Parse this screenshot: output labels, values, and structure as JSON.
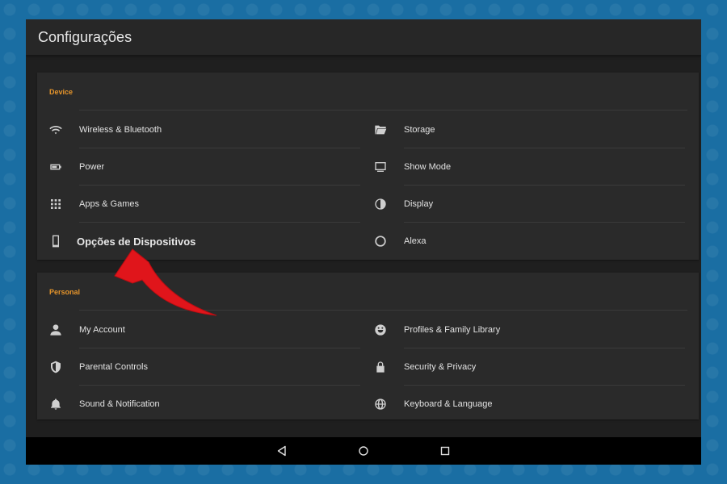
{
  "app": {
    "title": "Configurações"
  },
  "device": {
    "header": "Device",
    "left": [
      {
        "label": "Wireless & Bluetooth",
        "icon": "wifi-icon"
      },
      {
        "label": "Power",
        "icon": "battery-icon"
      },
      {
        "label": "Apps & Games",
        "icon": "apps-grid-icon"
      },
      {
        "label": "Opções de Dispositivos",
        "icon": "phone-icon"
      }
    ],
    "right": [
      {
        "label": "Storage",
        "icon": "folder-icon"
      },
      {
        "label": "Show Mode",
        "icon": "monitor-icon"
      },
      {
        "label": "Display",
        "icon": "contrast-icon"
      },
      {
        "label": "Alexa",
        "icon": "alexa-ring-icon"
      }
    ]
  },
  "personal": {
    "header": "Personal",
    "left": [
      {
        "label": "My Account",
        "icon": "person-icon"
      },
      {
        "label": "Parental Controls",
        "icon": "shield-icon"
      },
      {
        "label": "Sound & Notification",
        "icon": "bell-icon"
      }
    ],
    "right": [
      {
        "label": "Profiles & Family Library",
        "icon": "face-icon"
      },
      {
        "label": "Security & Privacy",
        "icon": "lock-icon"
      },
      {
        "label": "Keyboard & Language",
        "icon": "globe-icon"
      }
    ]
  },
  "navbar": {
    "back": "back-icon",
    "home": "home-icon",
    "recents": "recents-icon"
  },
  "colors": {
    "accent": "#e6952b",
    "arrow": "#e0151b",
    "frame": "#1a6ea3"
  }
}
